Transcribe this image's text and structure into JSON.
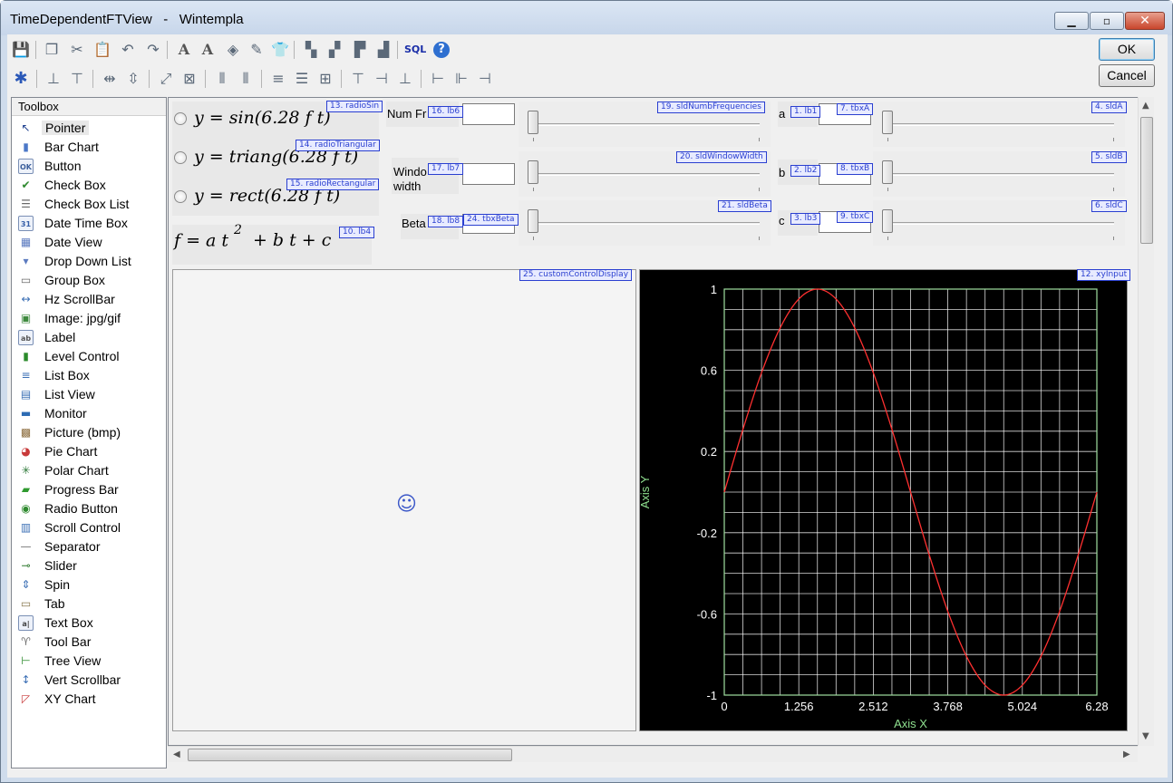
{
  "window": {
    "title": "TimeDependentFTView   -   Wintempla"
  },
  "buttons": {
    "ok": "OK",
    "cancel": "Cancel"
  },
  "toolbar_icons": {
    "row1": [
      "save-icon",
      "copy-icon",
      "cut-icon",
      "paste-icon",
      "undo-icon",
      "redo-icon",
      "font-icon",
      "font-color-icon",
      "fill-color-icon",
      "pencils-icon",
      "tshirt-icon",
      "bring-front-icon",
      "send-back-icon",
      "bring-forward-icon",
      "send-backward-icon",
      "sql-icon",
      "help-icon"
    ],
    "row2": [
      "tab-order-icon",
      "align-center-h-icon",
      "align-center-v-icon",
      "space-h-icon",
      "space-v-icon",
      "same-size-icon",
      "fit-icon",
      "col-a-icon",
      "col-b-icon",
      "row-a-icon",
      "row-b-icon",
      "grid-icon",
      "align-top-icon",
      "align-middle-icon",
      "align-bottom-icon",
      "align-left-icon",
      "align-center-icon",
      "align-right-icon"
    ],
    "sql_label": "SQL"
  },
  "toolbox": {
    "title": "Toolbox",
    "items": [
      "Pointer",
      "Bar Chart",
      "Button",
      "Check Box",
      "Check Box List",
      "Date Time Box",
      "Date View",
      "Drop Down List",
      "Group Box",
      "Hz ScrollBar",
      "Image: jpg/gif",
      "Label",
      "Level Control",
      "List Box",
      "List View",
      "Monitor",
      "Picture (bmp)",
      "Pie Chart",
      "Polar Chart",
      "Progress Bar",
      "Radio Button",
      "Scroll Control",
      "Separator",
      "Slider",
      "Spin",
      "Tab",
      "Text Box",
      "Tool Bar",
      "Tree View",
      "Vert Scrollbar",
      "XY Chart"
    ],
    "icon_glyphs": [
      "↖",
      "▮",
      "OK",
      "✔",
      "☰",
      "31",
      "▦",
      "▾",
      "▭",
      "↔",
      "▣",
      "ab",
      "▮",
      "≡",
      "▤",
      "▬",
      "▩",
      "◕",
      "✳",
      "▰",
      "◉",
      "▥",
      "—",
      "⊸",
      "⇕",
      "▭",
      "a|",
      "♈",
      "⊢",
      "↕",
      "◸"
    ],
    "icon_colors": [
      "#1d3f8f",
      "#4c78c8",
      "#3b5f9c",
      "#2f8a2f",
      "#6a6a6a",
      "#365fa8",
      "#5c7bc0",
      "#5c7bc0",
      "#6a6a6a",
      "#3b6fb5",
      "#3f8a3f",
      "#555",
      "#2a8a2a",
      "#3b6fb5",
      "#3b6fb5",
      "#2d6bb3",
      "#8a6a3a",
      "#c83a3a",
      "#2f7a3a",
      "#2f9a2f",
      "#2f8a2f",
      "#3b6fb5",
      "#777",
      "#2f7a2f",
      "#3b6fb5",
      "#8a7a50",
      "#444",
      "#6a6a6a",
      "#2a8a2a",
      "#3b6fb5",
      "#c83a3a"
    ]
  },
  "designer": {
    "radios": [
      {
        "formula": "y = sin(6.28 f t)",
        "tag": "13. radioSin"
      },
      {
        "formula": "y = triang(6.28 f t)",
        "tag": "14. radioTriangular"
      },
      {
        "formula": "y = rect(6.28 f t)",
        "tag": "15. radioRectangular"
      }
    ],
    "main_formula": {
      "base": "f = a t",
      "exp": "2",
      "rest": "+ b t + c",
      "tag": "10. lb4"
    },
    "labels": {
      "numf": "Num Fr",
      "numf_tag": "16. lb6",
      "window": "Windo\nwidth",
      "window_tag": "17. lb7",
      "beta": "Beta",
      "beta_tag": "18. lb8",
      "a": "a",
      "a_tag": "1. lb1",
      "b": "b",
      "b_tag": "2. lb2",
      "c": "c",
      "c_tag": "3. lb3"
    },
    "textboxes": {
      "tbxA": "7. tbxA",
      "tbxB": "8. tbxB",
      "tbxC": "9. tbxC",
      "tbxBeta": "24. tbxBeta"
    },
    "sliders": {
      "numb": "19. sldNumbFrequencies",
      "window": "20. sldWindowWidth",
      "beta": "21. sldBeta",
      "a": "4. sldA",
      "b": "5. sldB",
      "c": "6. sldC"
    },
    "custom_tag": "25. customControlDisplay",
    "chart_tag": "12. xyInput"
  },
  "colors": {
    "tag_border": "#2a3fd0",
    "grid": "#ffffff",
    "axis_frame": "#9fe09f",
    "curve": "#ff3030",
    "axis_text": "#ffffff",
    "axis_label": "#8fe08f"
  },
  "chart_data": {
    "type": "line",
    "title": "",
    "xlabel": "Axis X",
    "ylabel": "Axis Y",
    "xlim": [
      0,
      6.28
    ],
    "ylim": [
      -1,
      1
    ],
    "x_ticks": [
      "0",
      "1.256",
      "2.512",
      "3.768",
      "5.024",
      "6.28"
    ],
    "y_ticks": [
      "1",
      "0.6",
      "0.2",
      "-0.2",
      "-0.6",
      "-1"
    ],
    "grid": true,
    "series": [
      {
        "x": [
          0,
          0.314,
          0.628,
          0.942,
          1.256,
          1.57,
          1.884,
          2.198,
          2.512,
          2.826,
          3.14,
          3.454,
          3.768,
          4.082,
          4.396,
          4.71,
          5.024,
          5.338,
          5.652,
          5.966,
          6.28
        ],
        "y": [
          0,
          0.309,
          0.588,
          0.809,
          0.951,
          1,
          0.951,
          0.809,
          0.588,
          0.309,
          0,
          -0.309,
          -0.588,
          -0.809,
          -0.951,
          -1,
          -0.951,
          -0.809,
          -0.588,
          -0.309,
          0
        ]
      }
    ]
  }
}
